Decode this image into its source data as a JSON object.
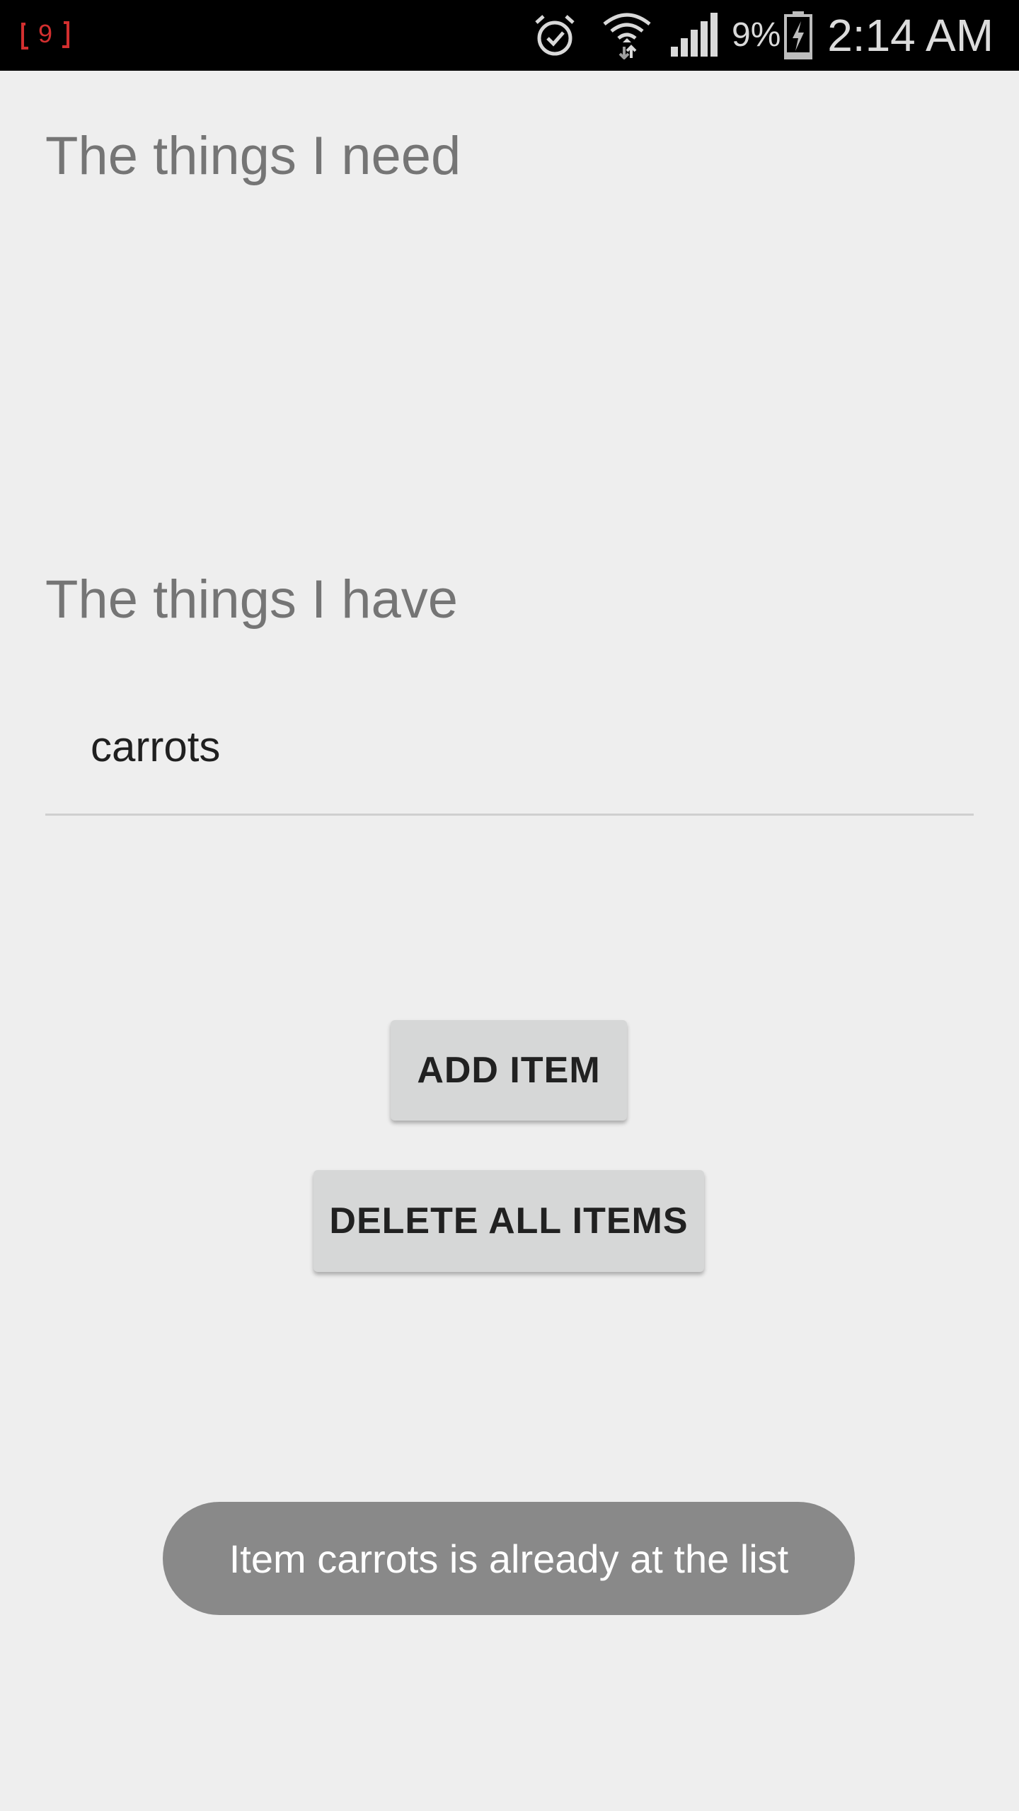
{
  "status_bar": {
    "notification_badge": "9",
    "notification_color": "#d32f2f",
    "icons": [
      "alarm-icon",
      "wifi-icon",
      "signal-icon",
      "battery-charging-icon"
    ],
    "battery_percent": "9%",
    "time": "2:14 AM"
  },
  "sections": {
    "need_title": "The things I need",
    "have_title": "The things I have"
  },
  "have_items": [
    {
      "label": "carrots"
    }
  ],
  "buttons": {
    "add_label": "ADD ITEM",
    "delete_all_label": "DELETE ALL ITEMS"
  },
  "toast": {
    "message": "Item carrots is already at the list"
  },
  "colors": {
    "background": "#eeeeee",
    "status_bar": "#000000",
    "button": "#d6d7d7",
    "toast": "#898989"
  }
}
